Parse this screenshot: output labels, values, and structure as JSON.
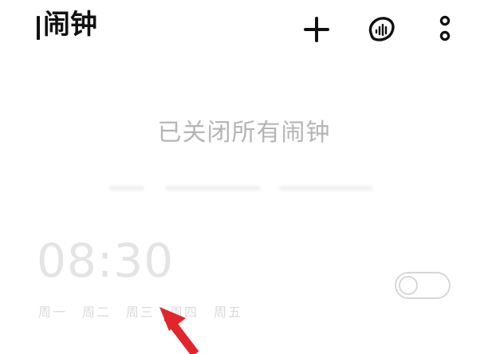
{
  "header": {
    "title": "闹钟",
    "add_icon": "plus-icon",
    "sound_icon": "sound-wave-icon",
    "more_icon": "more-vertical-icon"
  },
  "status_text": "已关闭所有闹钟",
  "alarm": {
    "time": "08:30",
    "days": [
      "周一",
      "周二",
      "周三",
      "周四",
      "周五"
    ],
    "toggle": {
      "on": false,
      "knob": "○"
    }
  },
  "annotation": {
    "arrow_color": "#e0262b",
    "arrow_icon": "red-arrow-icon"
  },
  "colors": {
    "background": "#ffffff",
    "title": "#111111",
    "status_text": "#b5b5b5",
    "alarm_disabled_text": "#e4e4e4"
  }
}
